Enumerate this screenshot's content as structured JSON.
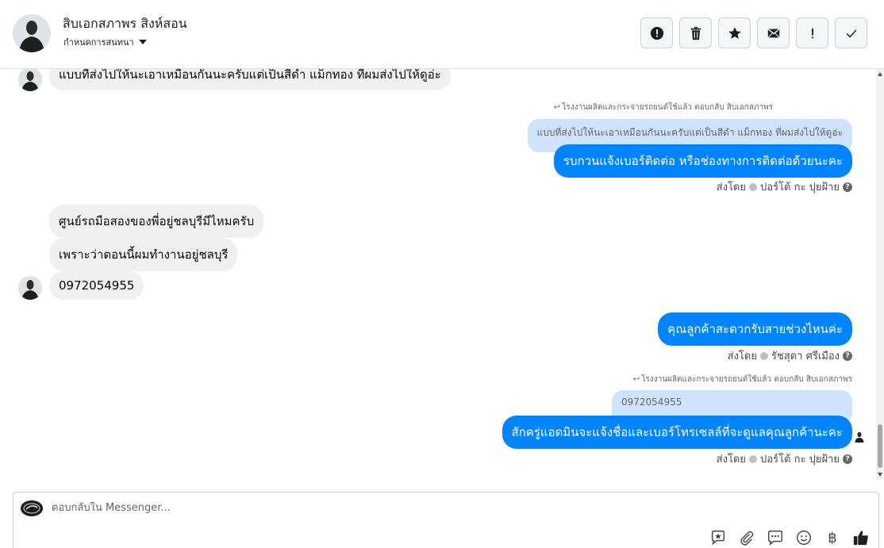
{
  "header": {
    "contact_name": "สิบเอกสภาพร สิงห์สอน",
    "label_link": "กำหนดการสนทนา",
    "actions": [
      {
        "name": "spam",
        "icon": "alert-circle-icon"
      },
      {
        "name": "delete",
        "icon": "trash-icon"
      },
      {
        "name": "star",
        "icon": "star-icon"
      },
      {
        "name": "mark-unread",
        "icon": "envelope-icon"
      },
      {
        "name": "important",
        "icon": "exclamation-icon"
      },
      {
        "name": "done",
        "icon": "check-icon"
      }
    ]
  },
  "messages": {
    "m1": "แบบที่ส่งไปให้นะเอาเหมือนกันนะครับแต่เป็นสีดำ แม็กทอง ที่ผมส่งไปให้ดูอ่ะ",
    "reply1_meta": "โรงงานผลิตและกระจายรถยนต์ใช้แล้ว ตอบกลับ สิบเอกสภาพร",
    "reply1_quote": "แบบที่ส่งไปให้นะเอาเหมือนกันนะครับแต่เป็นสีดำ แม็กทอง ที่ผมส่งไปให้ดูอ่ะ",
    "m2": "รบกวนแจ้งเบอร์ติดต่อ หรือช่องทางการติดต่อด้วยนะคะ",
    "m2_sender": "ส่งโดย",
    "m2_agent": "ปอร์โต้ กะ ปุยฝ้าย",
    "m3": "ศูนย์รถมือสองของพี่อยู่ชลบุรีมีไหมครับ",
    "m4": "เพราะว่าตอนนี้ผมทำงานอยู่ชลบุรี",
    "m5": "0972054955",
    "m6": "คุณลูกค้าสะดวกรับสายช่วงไหนค่ะ",
    "m6_sender": "ส่งโดย",
    "m6_agent": "รัชสุดา ศรีเมือง",
    "reply2_meta": "โรงงานผลิตและกระจายรถยนต์ใช้แล้ว ตอบกลับ สิบเอกสภาพร",
    "reply2_quote": "0972054955",
    "m7": "สักครู่แอดมินจะแจ้งชื่อและเบอร์โทรเซลล์ที่จะดูแลคุณลูกค้านะคะ",
    "m7_sender": "ส่งโดย",
    "m7_agent": "ปอร์โต้ กะ ปุยฝ้าย"
  },
  "composer": {
    "placeholder": "ตอบกลับใน Messenger...",
    "tools": [
      "sticker-icon",
      "attachment-icon",
      "saved-reply-icon",
      "emoji-icon",
      "baht-icon",
      "like-icon"
    ],
    "baht_symbol": "฿"
  },
  "colors": {
    "outgoing": "#0084ff",
    "incoming": "#f0f0f0",
    "quote": "#cfe3fe"
  }
}
